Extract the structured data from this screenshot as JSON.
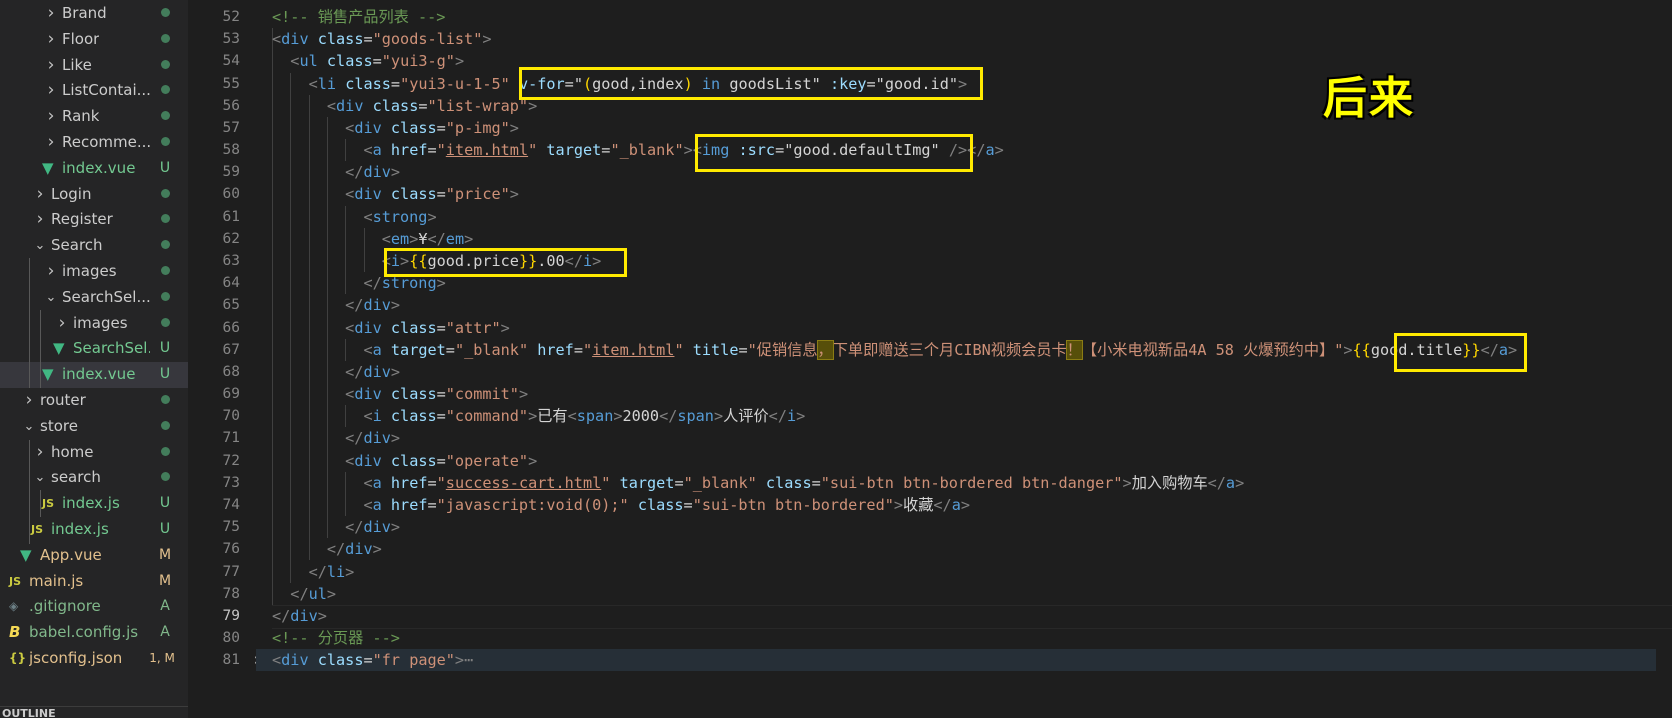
{
  "sidebar": {
    "items": [
      {
        "label": "Brand",
        "kind": "folder",
        "expanded": false,
        "depth": 2,
        "status": "dot"
      },
      {
        "label": "Floor",
        "kind": "folder",
        "expanded": false,
        "depth": 2,
        "status": "dot"
      },
      {
        "label": "Like",
        "kind": "folder",
        "expanded": false,
        "depth": 2,
        "status": "dot"
      },
      {
        "label": "ListContai...",
        "kind": "folder",
        "expanded": false,
        "depth": 2,
        "status": "dot"
      },
      {
        "label": "Rank",
        "kind": "folder",
        "expanded": false,
        "depth": 2,
        "status": "dot"
      },
      {
        "label": "Recomme...",
        "kind": "folder",
        "expanded": false,
        "depth": 2,
        "status": "dot"
      },
      {
        "label": "index.vue",
        "kind": "vue",
        "depth": 2,
        "status": "U"
      },
      {
        "label": "Login",
        "kind": "folder",
        "expanded": false,
        "depth": 1,
        "status": "dot"
      },
      {
        "label": "Register",
        "kind": "folder",
        "expanded": false,
        "depth": 1,
        "status": "dot"
      },
      {
        "label": "Search",
        "kind": "folder",
        "expanded": true,
        "depth": 1,
        "status": "dot"
      },
      {
        "label": "images",
        "kind": "folder",
        "expanded": false,
        "depth": 2,
        "status": "dot"
      },
      {
        "label": "SearchSel...",
        "kind": "folder",
        "expanded": true,
        "depth": 2,
        "status": "dot"
      },
      {
        "label": "images",
        "kind": "folder",
        "expanded": false,
        "depth": 3,
        "status": "dot"
      },
      {
        "label": "SearchSel...",
        "kind": "vue",
        "depth": 3,
        "status": "U"
      },
      {
        "label": "index.vue",
        "kind": "vue",
        "depth": 2,
        "status": "U",
        "active": true
      },
      {
        "label": "router",
        "kind": "folder",
        "expanded": false,
        "depth": 0,
        "status": "dot"
      },
      {
        "label": "store",
        "kind": "folder",
        "expanded": true,
        "depth": 0,
        "status": "dot"
      },
      {
        "label": "home",
        "kind": "folder",
        "expanded": false,
        "depth": 1,
        "status": "dot"
      },
      {
        "label": "search",
        "kind": "folder",
        "expanded": true,
        "depth": 1,
        "status": "dot"
      },
      {
        "label": "index.js",
        "kind": "js",
        "depth": 2,
        "status": "U"
      },
      {
        "label": "index.js",
        "kind": "js",
        "depth": 1,
        "status": "U"
      },
      {
        "label": "App.vue",
        "kind": "vue",
        "depth": 0,
        "status": "M"
      },
      {
        "label": "main.js",
        "kind": "js",
        "depth": -1,
        "status": "M"
      },
      {
        "label": ".gitignore",
        "kind": "git",
        "depth": -1,
        "status": "A"
      },
      {
        "label": "babel.config.js",
        "kind": "babel",
        "depth": -1,
        "status": "A"
      },
      {
        "label": "jsconfig.json",
        "kind": "json",
        "depth": -1,
        "status": "1, M"
      }
    ],
    "outline_label": "OUTLINE"
  },
  "colors": {
    "status_U": "#73c991",
    "status_M": "#e2c08d",
    "status_A": "#81b88b",
    "annotation": "#ffff00"
  },
  "editor": {
    "lines": [
      {
        "n": "52",
        "code": "<!-- 销售产品列表 -->"
      },
      {
        "n": "53",
        "code": "<div class=\"goods-list\">"
      },
      {
        "n": "54",
        "code": "  <ul class=\"yui3-g\">"
      },
      {
        "n": "55",
        "code": "    <li class=\"yui3-u-1-5\" v-for=\"(good,index) in goodsList\" :key=\"good.id\">"
      },
      {
        "n": "56",
        "code": "      <div class=\"list-wrap\">"
      },
      {
        "n": "57",
        "code": "        <div class=\"p-img\">"
      },
      {
        "n": "58",
        "code": "          <a href=\"item.html\" target=\"_blank\"><img :src=\"good.defaultImg\" /></a>"
      },
      {
        "n": "59",
        "code": "        </div>"
      },
      {
        "n": "60",
        "code": "        <div class=\"price\">"
      },
      {
        "n": "61",
        "code": "          <strong>"
      },
      {
        "n": "62",
        "code": "            <em>¥</em>"
      },
      {
        "n": "63",
        "code": "            <i>{{good.price}}.00</i>"
      },
      {
        "n": "64",
        "code": "          </strong>"
      },
      {
        "n": "65",
        "code": "        </div>"
      },
      {
        "n": "66",
        "code": "        <div class=\"attr\">"
      },
      {
        "n": "67",
        "code": "          <a target=\"_blank\" href=\"item.html\" title=\"促销信息，下单即赠送三个月CIBN视频会员卡！【小米电视新品4A 58 火爆预约中】\">{{good.title}}</a>"
      },
      {
        "n": "68",
        "code": "        </div>"
      },
      {
        "n": "69",
        "code": "        <div class=\"commit\">"
      },
      {
        "n": "70",
        "code": "          <i class=\"command\">已有<span>2000</span>人评价</i>"
      },
      {
        "n": "71",
        "code": "        </div>"
      },
      {
        "n": "72",
        "code": "        <div class=\"operate\">"
      },
      {
        "n": "73",
        "code": "          <a href=\"success-cart.html\" target=\"_blank\" class=\"sui-btn btn-bordered btn-danger\">加入购物车</a>"
      },
      {
        "n": "74",
        "code": "          <a href=\"javascript:void(0);\" class=\"sui-btn btn-bordered\">收藏</a>"
      },
      {
        "n": "75",
        "code": "        </div>"
      },
      {
        "n": "76",
        "code": "      </div>"
      },
      {
        "n": "77",
        "code": "    </li>"
      },
      {
        "n": "78",
        "code": "  </ul>"
      },
      {
        "n": "79",
        "code": "</div>"
      },
      {
        "n": "80",
        "code": "<!-- 分页器 -->"
      },
      {
        "n": "81",
        "code": "<div class=\"fr page\">⋯"
      }
    ],
    "current_line": "79",
    "folded_line": "81"
  },
  "annotation": {
    "text": "后来"
  }
}
